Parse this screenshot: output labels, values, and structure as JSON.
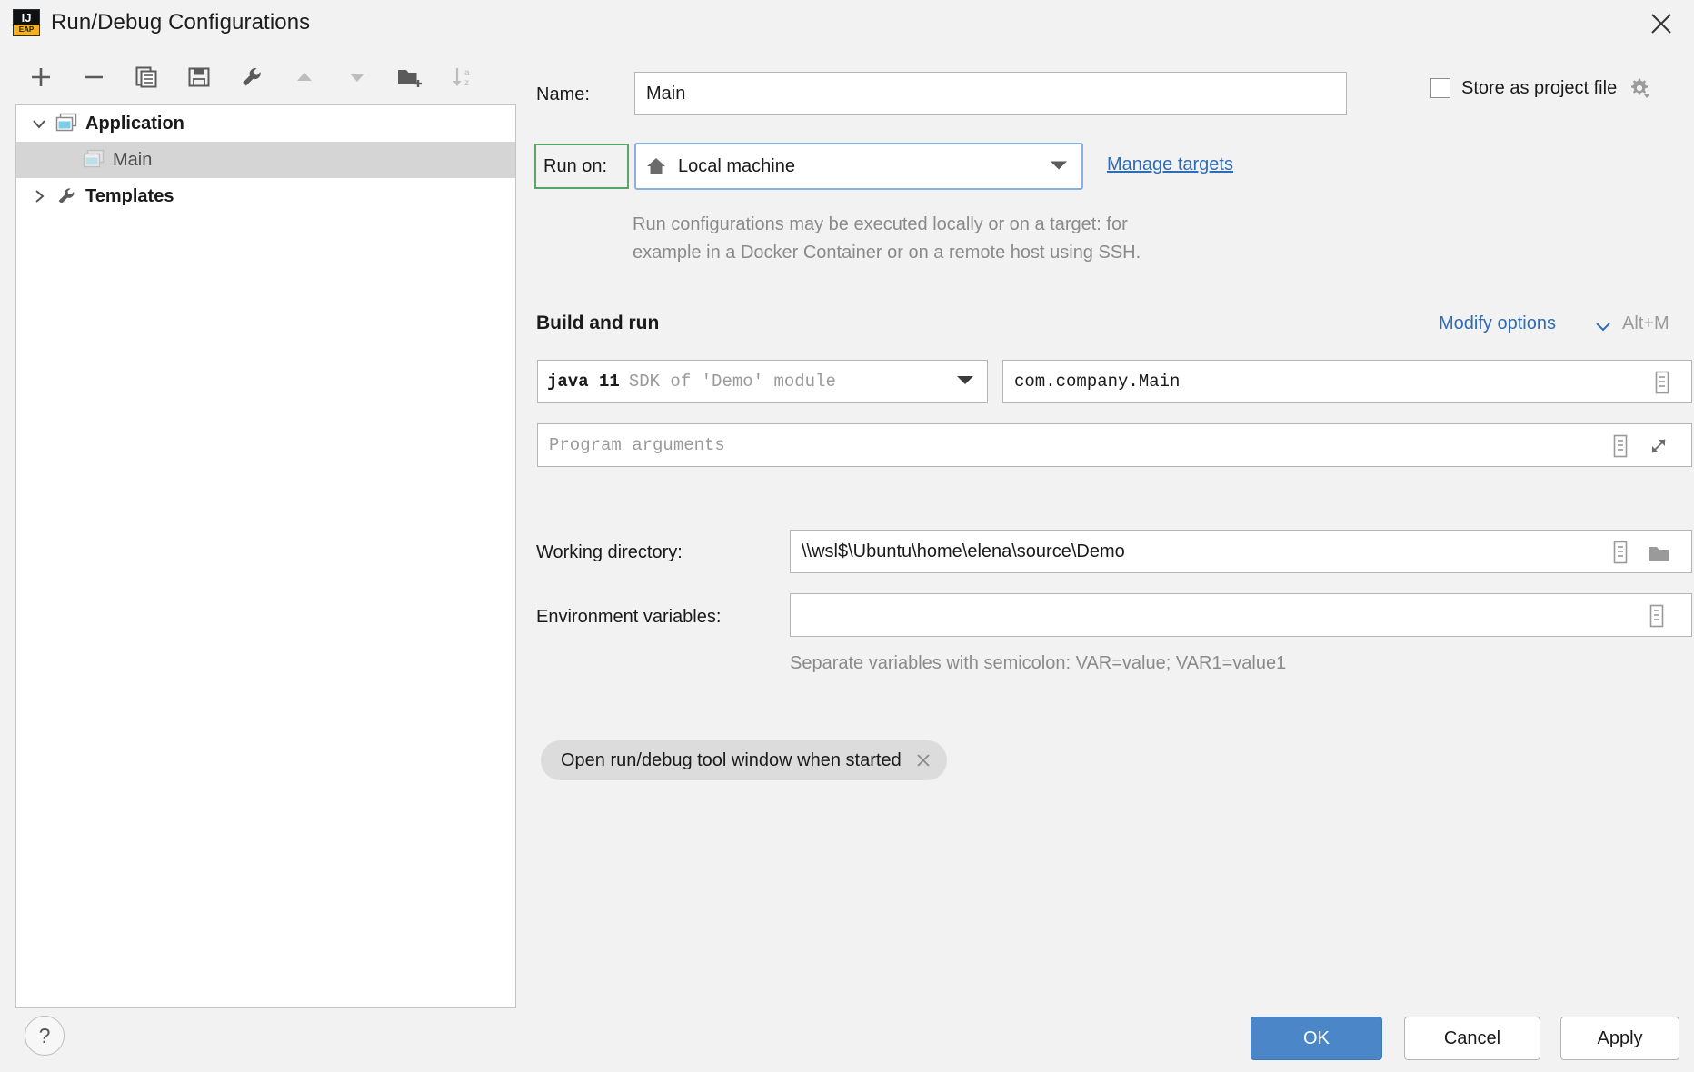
{
  "window": {
    "title": "Run/Debug Configurations",
    "app_icon": "intellij-idea-icon",
    "app_icon_top": "IJ",
    "app_icon_bottom": "EAP",
    "close_label": "close-icon"
  },
  "toolbar": {
    "buttons": [
      {
        "name": "add-configuration-button",
        "icon": "plus-icon",
        "tooltip": "Add New Configuration",
        "enabled": true
      },
      {
        "name": "remove-configuration-button",
        "icon": "minus-icon",
        "tooltip": "Remove Configuration",
        "enabled": true
      },
      {
        "name": "copy-configuration-button",
        "icon": "copy-icon",
        "tooltip": "Copy Configuration",
        "enabled": true
      },
      {
        "name": "save-configuration-button",
        "icon": "save-icon",
        "tooltip": "Save Configuration",
        "enabled": true
      },
      {
        "name": "edit-templates-button",
        "icon": "wrench-icon",
        "tooltip": "Edit Templates",
        "enabled": true
      },
      {
        "name": "move-up-button",
        "icon": "arrow-up-icon",
        "tooltip": "Move Up",
        "enabled": false
      },
      {
        "name": "move-down-button",
        "icon": "arrow-down-icon",
        "tooltip": "Move Down",
        "enabled": false
      },
      {
        "name": "new-folder-button",
        "icon": "folder-add-icon",
        "tooltip": "Create New Folder",
        "enabled": true
      },
      {
        "name": "sort-button",
        "icon": "sort-alphabetical-icon",
        "tooltip": "Sort Configurations",
        "enabled": false
      }
    ]
  },
  "tree": {
    "items": [
      {
        "label": "Application",
        "icon": "application-icon",
        "toggle": "chevron-down-icon",
        "level": 1,
        "bold": true,
        "selected": false
      },
      {
        "label": "Main",
        "icon": "application-icon-dim",
        "toggle": "",
        "level": 2,
        "bold": false,
        "selected": true
      },
      {
        "label": "Templates",
        "icon": "wrench-icon",
        "toggle": "chevron-right-icon",
        "level": 1,
        "bold": true,
        "selected": false
      }
    ]
  },
  "form": {
    "name_label": "Name:",
    "name_value": "Main",
    "store_as_project_file_label": "Store as project file",
    "store_as_project_file_checked": false,
    "store_gear_icon": "gear-dropdown-icon",
    "run_on_label": "Run on:",
    "run_on_value": "Local machine",
    "run_on_icon": "home-icon",
    "run_on_arrow": "chevron-down-icon",
    "manage_targets_link": "Manage targets",
    "run_on_hint": "Run configurations may be executed locally or on a target: for\nexample in a Docker Container or on a remote host using SSH.",
    "build_and_run_title": "Build and run",
    "modify_options_link": "Modify options",
    "modify_options_arrow": "chevron-down-icon",
    "modify_options_shortcut": "Alt+M",
    "jre_value_strong": "java 11",
    "jre_value_muted": "SDK of 'Demo' module",
    "main_class_value": "com.company.Main",
    "main_class_expand_icon": "list-dropdown-icon",
    "program_arguments_placeholder": "Program arguments",
    "program_arguments_value": "",
    "program_arguments_list_icon": "list-dropdown-icon",
    "program_arguments_expand_icon": "expand-diagonal-icon",
    "working_directory_label": "Working directory:",
    "working_directory_value": "\\\\wsl$\\Ubuntu\\home\\elena\\source\\Demo",
    "working_directory_list_icon": "list-dropdown-icon",
    "working_directory_browse_icon": "folder-icon",
    "environment_variables_label": "Environment variables:",
    "environment_variables_value": "",
    "environment_variables_list_icon": "list-dropdown-icon",
    "environment_variables_hint": "Separate variables with semicolon: VAR=value; VAR1=value1",
    "open_tool_window_chip": "Open run/debug tool window when started",
    "open_tool_window_chip_close": "close-icon"
  },
  "footer": {
    "help_label": "?",
    "ok_label": "OK",
    "cancel_label": "Cancel",
    "apply_label": "Apply"
  },
  "colors": {
    "accent_blue": "#4a86c8",
    "link_blue": "#2f6cb5",
    "focus_border": "#8ab0dd",
    "highlight_green": "#5aa469",
    "selection_gray": "#d5d5d5",
    "dialog_bg": "#f2f2f2",
    "brand_yellow": "#f2b01e"
  }
}
